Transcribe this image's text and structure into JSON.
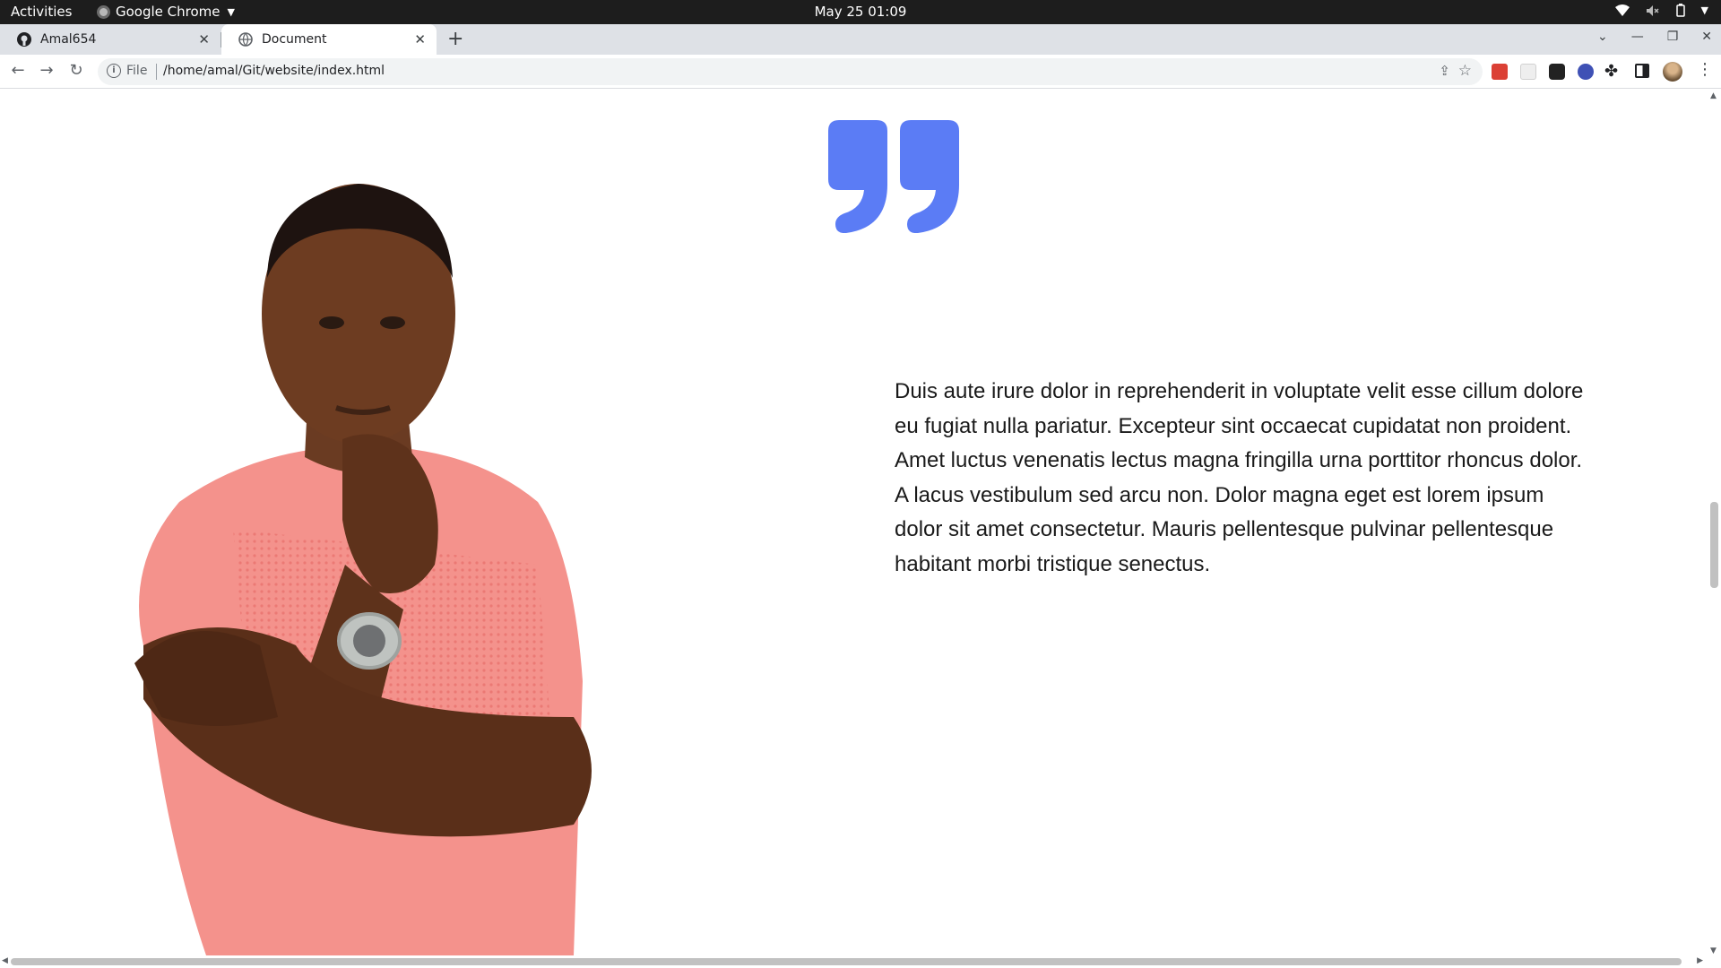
{
  "system_bar": {
    "activities": "Activities",
    "app_name": "Google Chrome",
    "clock": "May 25  01:09"
  },
  "tabs": [
    {
      "label": "Amal654",
      "icon": "github-icon",
      "active": false
    },
    {
      "label": "Document",
      "icon": "globe-icon",
      "active": true
    }
  ],
  "toolbar": {
    "scheme_label": "File",
    "url": "/home/amal/Git/website/index.html"
  },
  "page": {
    "quote_color": "#5b7cf5",
    "body_text": "Duis aute irure dolor in reprehenderit in voluptate velit esse cillum dolore eu fugiat nulla pariatur. Excepteur sint occaecat cupidatat non proident. Amet luctus venenatis lectus magna fringilla urna porttitor rhoncus dolor. A lacus vestibulum sed arcu non. Dolor magna eget est lorem ipsum dolor sit amet consectetur. Mauris pellentesque pulvinar pellentesque habitant morbi tristique senectus."
  }
}
